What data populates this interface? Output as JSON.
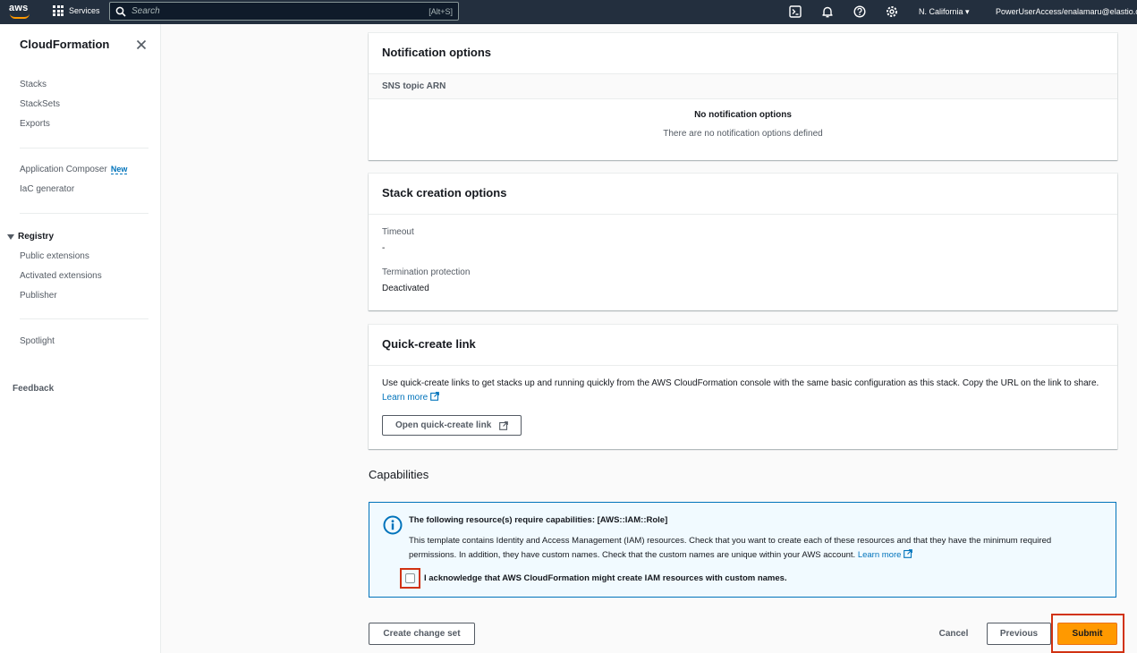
{
  "topnav": {
    "logo_text": "aws",
    "services_label": "Services",
    "search_placeholder": "Search",
    "search_shortcut": "[Alt+S]",
    "region_label": "N. California",
    "account_label": "PowerUserAccess/enalamaru@elastio.c"
  },
  "sidebar": {
    "title": "CloudFormation",
    "group1": [
      "Stacks",
      "StackSets",
      "Exports"
    ],
    "app_composer": "Application Composer",
    "new_badge": "New",
    "iac_generator": "IaC generator",
    "registry_label": "Registry",
    "registry_items": [
      "Public extensions",
      "Activated extensions",
      "Publisher"
    ],
    "spotlight": "Spotlight",
    "feedback": "Feedback"
  },
  "notification": {
    "title": "Notification options",
    "column_header": "SNS topic ARN",
    "empty_title": "No notification options",
    "empty_desc": "There are no notification options defined"
  },
  "stack_creation": {
    "title": "Stack creation options",
    "timeout_label": "Timeout",
    "timeout_value": "-",
    "termination_label": "Termination protection",
    "termination_value": "Deactivated"
  },
  "quick_create": {
    "title": "Quick-create link",
    "description": "Use quick-create links to get stacks up and running quickly from the AWS CloudFormation console with the same basic configuration as this stack. Copy the URL on the link to share.",
    "learn_more": "Learn more",
    "button_label": "Open quick-create link"
  },
  "capabilities": {
    "heading": "Capabilities",
    "alert_title": "The following resource(s) require capabilities: [AWS::IAM::Role]",
    "alert_text": "This template contains Identity and Access Management (IAM) resources. Check that you want to create each of these resources and that they have the minimum required permissions. In addition, they have custom names. Check that the custom names are unique within your AWS account.",
    "learn_more": "Learn more",
    "acknowledge_label": "I acknowledge that AWS CloudFormation might create IAM resources with custom names."
  },
  "footer": {
    "create_change_set": "Create change set",
    "cancel": "Cancel",
    "previous": "Previous",
    "submit": "Submit"
  },
  "colors": {
    "nav_bg": "#232f3e",
    "accent_orange": "#ff9900",
    "link_blue": "#0073bb",
    "highlight_red": "#d13212",
    "alert_bg": "#f1faff"
  },
  "icons": {
    "services": "grid-icon",
    "search": "search-icon",
    "cloudshell": "terminal-icon",
    "notifications": "bell-icon",
    "help": "help-icon",
    "settings": "gear-icon",
    "sidebar_close": "close-icon",
    "external": "external-link-icon",
    "alert": "info-icon"
  }
}
